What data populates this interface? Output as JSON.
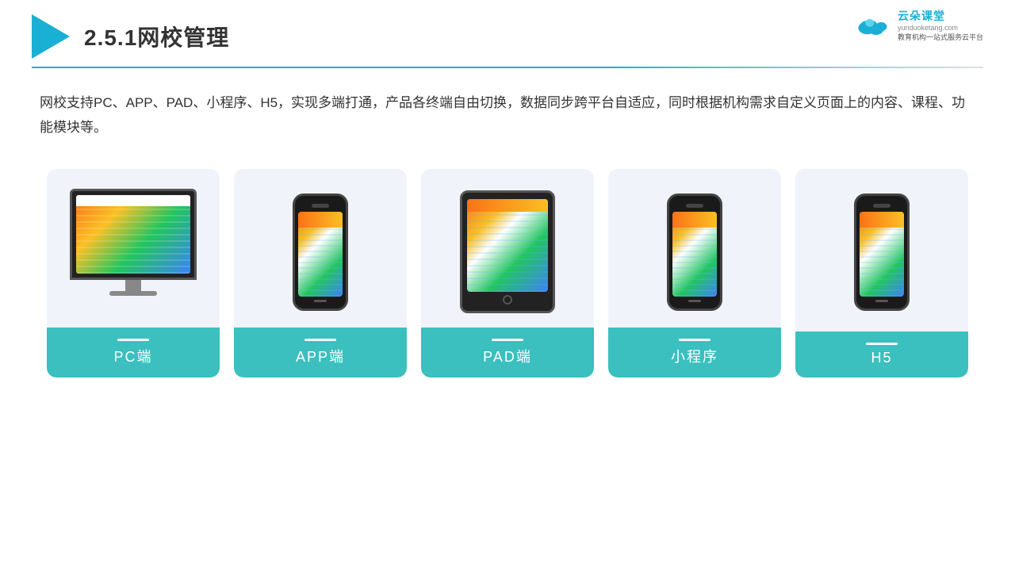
{
  "header": {
    "title": "2.5.1网校管理"
  },
  "brand": {
    "name": "云朵课堂",
    "url": "yunduoketang.com",
    "slogan": "教育机构一站式服务云平台"
  },
  "description": "网校支持PC、APP、PAD、小程序、H5，实现多端打通，产品各终端自由切换，数据同步跨平台自适应，同时根据机构需求自定义页面上的内容、课程、功能模块等。",
  "cards": [
    {
      "label": "PC端",
      "type": "pc"
    },
    {
      "label": "APP端",
      "type": "phone"
    },
    {
      "label": "PAD端",
      "type": "tablet"
    },
    {
      "label": "小程序",
      "type": "phone"
    },
    {
      "label": "H5",
      "type": "phone"
    }
  ]
}
